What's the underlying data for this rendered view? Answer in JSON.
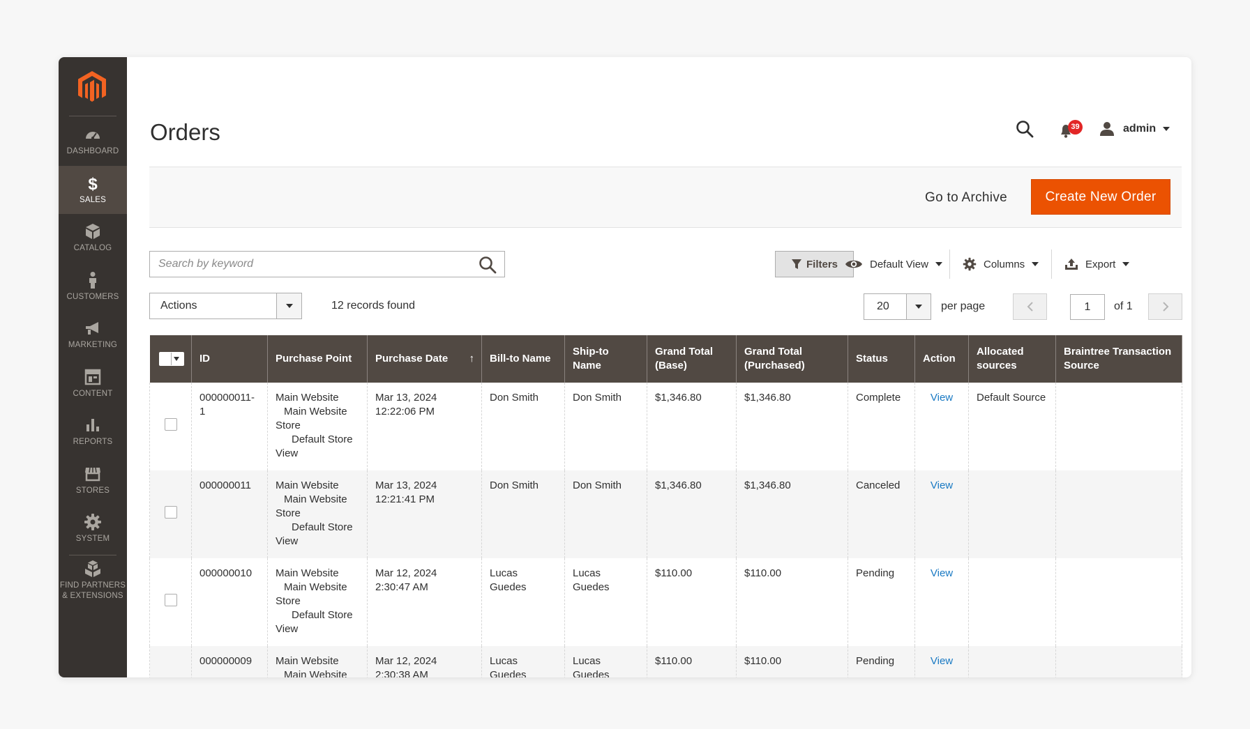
{
  "sidebar": {
    "items": [
      {
        "label": "Dashboard",
        "icon": "dashboard-icon"
      },
      {
        "label": "Sales",
        "icon": "dollar-icon",
        "active": true
      },
      {
        "label": "Catalog",
        "icon": "cube-icon"
      },
      {
        "label": "Customers",
        "icon": "person-icon"
      },
      {
        "label": "Marketing",
        "icon": "megaphone-icon"
      },
      {
        "label": "Content",
        "icon": "layout-icon"
      },
      {
        "label": "Reports",
        "icon": "bar-chart-icon"
      },
      {
        "label": "Stores",
        "icon": "storefront-icon"
      },
      {
        "label": "System",
        "icon": "gear-icon"
      }
    ],
    "extra": {
      "line1": "Find Partners",
      "line2": "& Extensions",
      "icon": "boxes-icon"
    }
  },
  "header": {
    "title": "Orders",
    "notifications_count": "39",
    "user_name": "admin"
  },
  "action_bar": {
    "archive_label": "Go to Archive",
    "create_label": "Create New Order"
  },
  "toolbar": {
    "search_placeholder": "Search by keyword",
    "filters_label": "Filters",
    "view_label": "Default View",
    "columns_label": "Columns",
    "export_label": "Export",
    "actions_label": "Actions",
    "records_found": "12 records found",
    "per_page_value": "20",
    "per_page_label": "per page",
    "page_value": "1",
    "page_of": "of 1"
  },
  "grid": {
    "columns": [
      "ID",
      "Purchase Point",
      "Purchase Date",
      "Bill-to Name",
      "Ship-to Name",
      "Grand Total (Base)",
      "Grand Total (Purchased)",
      "Status",
      "Action",
      "Allocated sources",
      "Braintree Transaction Source"
    ],
    "purchase_point": [
      "Main Website",
      "Main Website",
      "Store",
      "Default Store",
      "View"
    ],
    "rows": [
      {
        "id": "000000011-1",
        "date": "Mar 13, 2024 12:22:06 PM",
        "bill_to": "Don Smith",
        "ship_to": "Don Smith",
        "total_base": "$1,346.80",
        "total_purchased": "$1,346.80",
        "status": "Complete",
        "action": "View",
        "sources": "Default Source",
        "braintree": ""
      },
      {
        "id": "000000011",
        "date": "Mar 13, 2024 12:21:41 PM",
        "bill_to": "Don Smith",
        "ship_to": "Don Smith",
        "total_base": "$1,346.80",
        "total_purchased": "$1,346.80",
        "status": "Canceled",
        "action": "View",
        "sources": "",
        "braintree": ""
      },
      {
        "id": "000000010",
        "date": "Mar 12, 2024 2:30:47 AM",
        "bill_to": "Lucas Guedes",
        "ship_to": "Lucas Guedes",
        "total_base": "$110.00",
        "total_purchased": "$110.00",
        "status": "Pending",
        "action": "View",
        "sources": "",
        "braintree": ""
      },
      {
        "id": "000000009",
        "date": "Mar 12, 2024 2:30:38 AM",
        "bill_to": "Lucas Guedes",
        "ship_to": "Lucas Guedes",
        "total_base": "$110.00",
        "total_purchased": "$110.00",
        "status": "Pending",
        "action": "View",
        "sources": "",
        "braintree": ""
      }
    ]
  },
  "colors": {
    "sidebar_bg": "#373330",
    "sidebar_active": "#514943",
    "header_bg": "#514943",
    "primary_button": "#eb5202",
    "link": "#1979c3",
    "badge": "#e22626"
  }
}
